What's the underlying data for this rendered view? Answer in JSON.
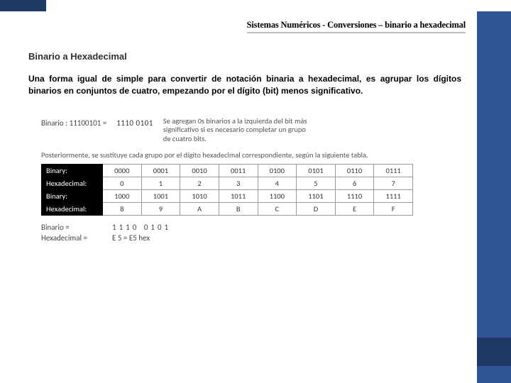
{
  "header": {
    "title": "Sistemas Numéricos  - Conversiones – binario a hexadecimal"
  },
  "section": {
    "heading": "Binario a Hexadecimal",
    "paragraph": "Una forma igual de simple para convertir de notación binaria a hexadecimal, es agrupar los dígitos binarios en conjuntos de cuatro, empezando por el dígito (bit) menos significativo."
  },
  "example": {
    "binary_label": "Binario : 11100101 =",
    "binary_grouped": "1110 0101",
    "note": "Se agregan 0s binarios a la izquierda del bit más significativo si es necesario completar un grupo de cuatro bits.",
    "substitute_text": "Posteriormente, se sustituye cada grupo por el dígito hexadecimal correspondiente, según la siguiente tabla.",
    "table": {
      "row_labels": [
        "Binary:",
        "Hexadecimal:",
        "Binary:",
        "Hexadecimal:"
      ],
      "r1": [
        "0000",
        "0001",
        "0010",
        "0011",
        "0100",
        "0101",
        "0110",
        "0111"
      ],
      "r2": [
        "0",
        "1",
        "2",
        "3",
        "4",
        "5",
        "6",
        "7"
      ],
      "r3": [
        "1000",
        "1001",
        "1010",
        "1011",
        "1100",
        "1101",
        "1110",
        "1111"
      ],
      "r4": [
        "8",
        "9",
        "A",
        "B",
        "C",
        "D",
        "E",
        "F"
      ]
    },
    "result": {
      "bin_label": "Binario  =",
      "bin_value": "1110 0101",
      "hex_label": "Hexadecimal =",
      "hex_value": "E     5 = E5 hex"
    }
  }
}
